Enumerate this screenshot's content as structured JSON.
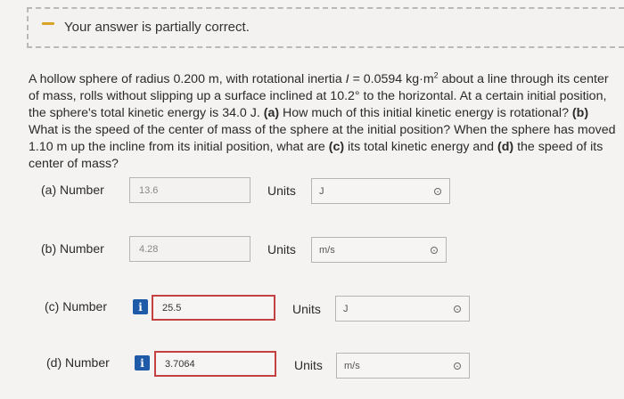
{
  "feedback": {
    "message": "Your answer is partially correct."
  },
  "question": {
    "text_part1": "A hollow sphere of radius 0.200 m, with rotational inertia ",
    "var_I": "I",
    "text_part2": " = 0.0594 kg·m",
    "exp": "2",
    "text_part3": " about a line through its center of mass, rolls without slipping up a surface inclined at 10.2° to the horizontal. At a certain initial position, the sphere's total kinetic energy is 34.0 J. ",
    "a_tag": "(a)",
    "a_text": " How much of this initial kinetic energy is rotational? ",
    "b_tag": "(b)",
    "b_text": " What is the speed of the center of mass of the sphere at the initial position? When the sphere has moved 1.10 m up the incline from its initial position, what are ",
    "c_tag": "(c)",
    "c_text": " its total kinetic energy and ",
    "d_tag": "(d)",
    "d_text": " the speed of its center of mass?"
  },
  "answers": [
    {
      "label": "(a)   Number",
      "value": "13.6",
      "units_label": "Units",
      "unit": "J",
      "error": false
    },
    {
      "label": "(b)   Number",
      "value": "4.28",
      "units_label": "Units",
      "unit": "m/s",
      "error": false
    },
    {
      "label": "(c)   Number",
      "value": "25.5",
      "units_label": "Units",
      "unit": "J",
      "error": true,
      "info": "i"
    },
    {
      "label": "(d)   Number",
      "value": "3.7064",
      "units_label": "Units",
      "unit": "m/s",
      "error": true,
      "info": "i"
    }
  ],
  "colors": {
    "accent": "#1f5aa8",
    "error": "#c54141",
    "feedback": "#d8a327"
  }
}
